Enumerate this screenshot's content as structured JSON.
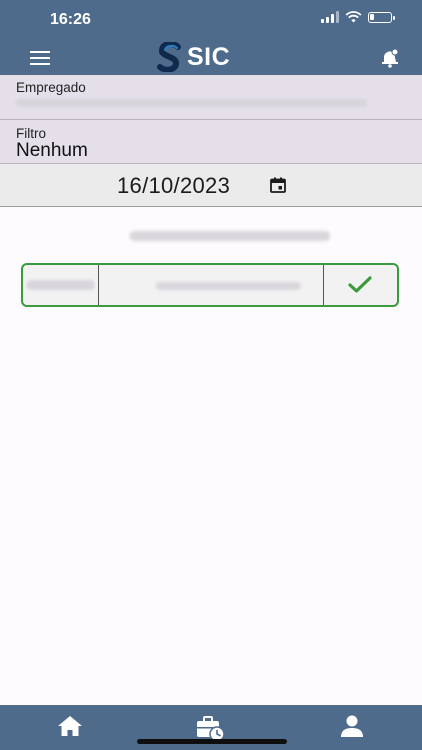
{
  "status_bar": {
    "time": "16:26",
    "battery_level": 0.2
  },
  "header": {
    "app_name": "SIC",
    "menu_icon": "hamburger-menu-icon",
    "notification_icon": "bell-icon",
    "colors": {
      "bar": "#4e6b8c"
    }
  },
  "form": {
    "empregado_label": "Empregado",
    "filtro_label": "Filtro",
    "filtro_value": "Nenhum",
    "date_value": "16/10/2023",
    "date_icon": "calendar-icon"
  },
  "entry": {
    "check_icon": "checkmark-icon",
    "accent": "#3a9a3c"
  },
  "bottom_nav": {
    "tabs": [
      {
        "icon": "home-icon"
      },
      {
        "icon": "briefcase-clock-icon"
      },
      {
        "icon": "person-icon"
      }
    ]
  }
}
